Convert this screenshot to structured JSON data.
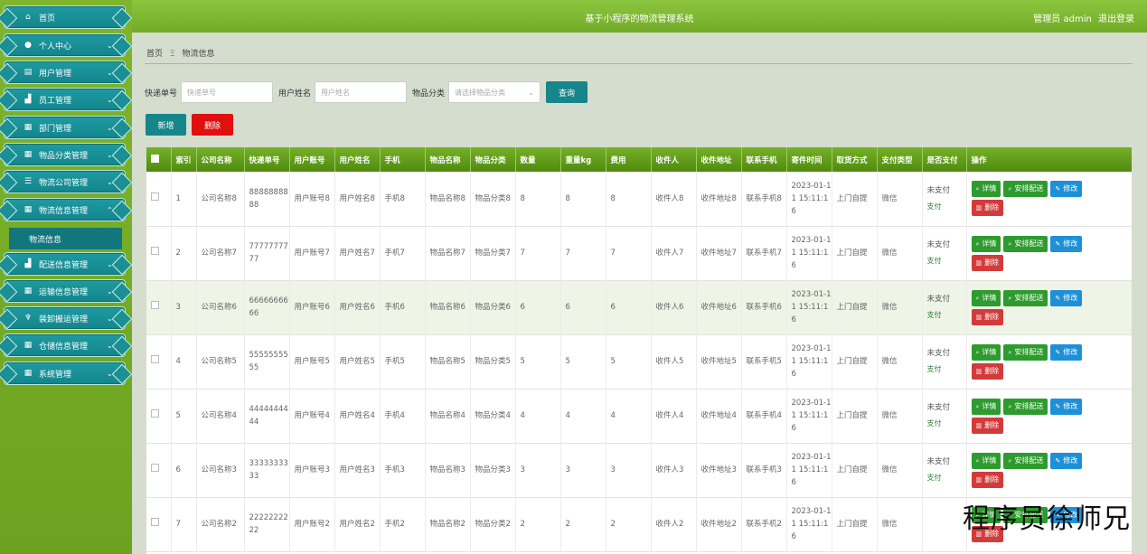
{
  "header": {
    "title": "基于小程序的物流管理系统",
    "user": "管理员 admin",
    "logout": "退出登录"
  },
  "sidebar": {
    "items": [
      {
        "label": "首页",
        "icon": "home-icon",
        "glyph": "⌂",
        "chev": ""
      },
      {
        "label": "个人中心",
        "icon": "user-icon",
        "glyph": "●",
        "chev": "⌄"
      },
      {
        "label": "用户管理",
        "icon": "card-icon",
        "glyph": "▤",
        "chev": "⌄"
      },
      {
        "label": "员工管理",
        "icon": "chart-icon",
        "glyph": "▟",
        "chev": "⌄"
      },
      {
        "label": "部门管理",
        "icon": "grid-icon",
        "glyph": "▦",
        "chev": "⌄"
      },
      {
        "label": "物品分类管理",
        "icon": "grid-icon",
        "glyph": "▦",
        "chev": "⌄"
      },
      {
        "label": "物流公司管理",
        "icon": "sliders-icon",
        "glyph": "☰",
        "chev": "⌄"
      },
      {
        "label": "物流信息管理",
        "icon": "grid-icon",
        "glyph": "▦",
        "chev": "⌃"
      },
      {
        "label": "配送信息管理",
        "icon": "bar-icon",
        "glyph": "▟",
        "chev": "⌄"
      },
      {
        "label": "运输信息管理",
        "icon": "grid-icon",
        "glyph": "▦",
        "chev": "⌄"
      },
      {
        "label": "装卸搬运管理",
        "icon": "trophy-icon",
        "glyph": "♆",
        "chev": "⌄"
      },
      {
        "label": "仓储信息管理",
        "icon": "grid-icon",
        "glyph": "▦",
        "chev": "⌄"
      },
      {
        "label": "系统管理",
        "icon": "grid-icon",
        "glyph": "▦",
        "chev": "⌄"
      }
    ],
    "active_sub": "物流信息"
  },
  "breadcrumb": {
    "home": "首页",
    "sep": "Ξ",
    "current": "物流信息"
  },
  "search": {
    "tracking_label": "快递单号",
    "tracking_placeholder": "快递单号",
    "username_label": "用户姓名",
    "username_placeholder": "用户姓名",
    "category_label": "物品分类",
    "category_placeholder": "请选择物品分类",
    "query_button": "查询"
  },
  "actions": {
    "add": "新增",
    "delete": "删除"
  },
  "table": {
    "columns": [
      "索引",
      "公司名称",
      "快递单号",
      "用户账号",
      "用户姓名",
      "手机",
      "物品名称",
      "物品分类",
      "数量",
      "重量kg",
      "费用",
      "收件人",
      "收件地址",
      "联系手机",
      "寄件时间",
      "取货方式",
      "支付类型",
      "是否支付",
      "操作"
    ],
    "rows": [
      {
        "idx": "1",
        "company": "公司名称8",
        "tracking": "8888888888",
        "account": "用户账号8",
        "name": "用户姓名8",
        "phone": "手机8",
        "item": "物品名称8",
        "category": "物品分类8",
        "qty": "8",
        "weight": "8",
        "fee": "8",
        "receiver": "收件人8",
        "address": "收件地址8",
        "contact": "联系手机8",
        "time": "2023-01-11 15:11:16",
        "pickup": "上门自提",
        "paytype": "微信",
        "paid": "未支付",
        "paylink": "支付"
      },
      {
        "idx": "2",
        "company": "公司名称7",
        "tracking": "7777777777",
        "account": "用户账号7",
        "name": "用户姓名7",
        "phone": "手机7",
        "item": "物品名称7",
        "category": "物品分类7",
        "qty": "7",
        "weight": "7",
        "fee": "7",
        "receiver": "收件人7",
        "address": "收件地址7",
        "contact": "联系手机7",
        "time": "2023-01-11 15:11:16",
        "pickup": "上门自提",
        "paytype": "微信",
        "paid": "未支付",
        "paylink": "支付"
      },
      {
        "idx": "3",
        "company": "公司名称6",
        "tracking": "6666666666",
        "account": "用户账号6",
        "name": "用户姓名6",
        "phone": "手机6",
        "item": "物品名称6",
        "category": "物品分类6",
        "qty": "6",
        "weight": "6",
        "fee": "6",
        "receiver": "收件人6",
        "address": "收件地址6",
        "contact": "联系手机6",
        "time": "2023-01-11 15:11:16",
        "pickup": "上门自提",
        "paytype": "微信",
        "paid": "未支付",
        "paylink": "支付"
      },
      {
        "idx": "4",
        "company": "公司名称5",
        "tracking": "5555555555",
        "account": "用户账号5",
        "name": "用户姓名5",
        "phone": "手机5",
        "item": "物品名称5",
        "category": "物品分类5",
        "qty": "5",
        "weight": "5",
        "fee": "5",
        "receiver": "收件人5",
        "address": "收件地址5",
        "contact": "联系手机5",
        "time": "2023-01-11 15:11:16",
        "pickup": "上门自提",
        "paytype": "微信",
        "paid": "未支付",
        "paylink": "支付"
      },
      {
        "idx": "5",
        "company": "公司名称4",
        "tracking": "4444444444",
        "account": "用户账号4",
        "name": "用户姓名4",
        "phone": "手机4",
        "item": "物品名称4",
        "category": "物品分类4",
        "qty": "4",
        "weight": "4",
        "fee": "4",
        "receiver": "收件人4",
        "address": "收件地址4",
        "contact": "联系手机4",
        "time": "2023-01-11 15:11:16",
        "pickup": "上门自提",
        "paytype": "微信",
        "paid": "未支付",
        "paylink": "支付"
      },
      {
        "idx": "6",
        "company": "公司名称3",
        "tracking": "3333333333",
        "account": "用户账号3",
        "name": "用户姓名3",
        "phone": "手机3",
        "item": "物品名称3",
        "category": "物品分类3",
        "qty": "3",
        "weight": "3",
        "fee": "3",
        "receiver": "收件人3",
        "address": "收件地址3",
        "contact": "联系手机3",
        "time": "2023-01-11 15:11:16",
        "pickup": "上门自提",
        "paytype": "微信",
        "paid": "未支付",
        "paylink": "支付"
      },
      {
        "idx": "7",
        "company": "公司名称2",
        "tracking": "2222222222",
        "account": "用户账号2",
        "name": "用户姓名2",
        "phone": "手机2",
        "item": "物品名称2",
        "category": "物品分类2",
        "qty": "2",
        "weight": "2",
        "fee": "2",
        "receiver": "收件人2",
        "address": "收件地址2",
        "contact": "联系手机2",
        "time": "2023-01-11 15:11:16",
        "pickup": "上门自提",
        "paytype": "微信",
        "paid": "",
        "paylink": ""
      }
    ],
    "op_labels": {
      "detail": "详情",
      "dispatch": "安排配送",
      "edit": "修改",
      "delete": "删除"
    }
  },
  "watermark": "程序员徐师兄"
}
